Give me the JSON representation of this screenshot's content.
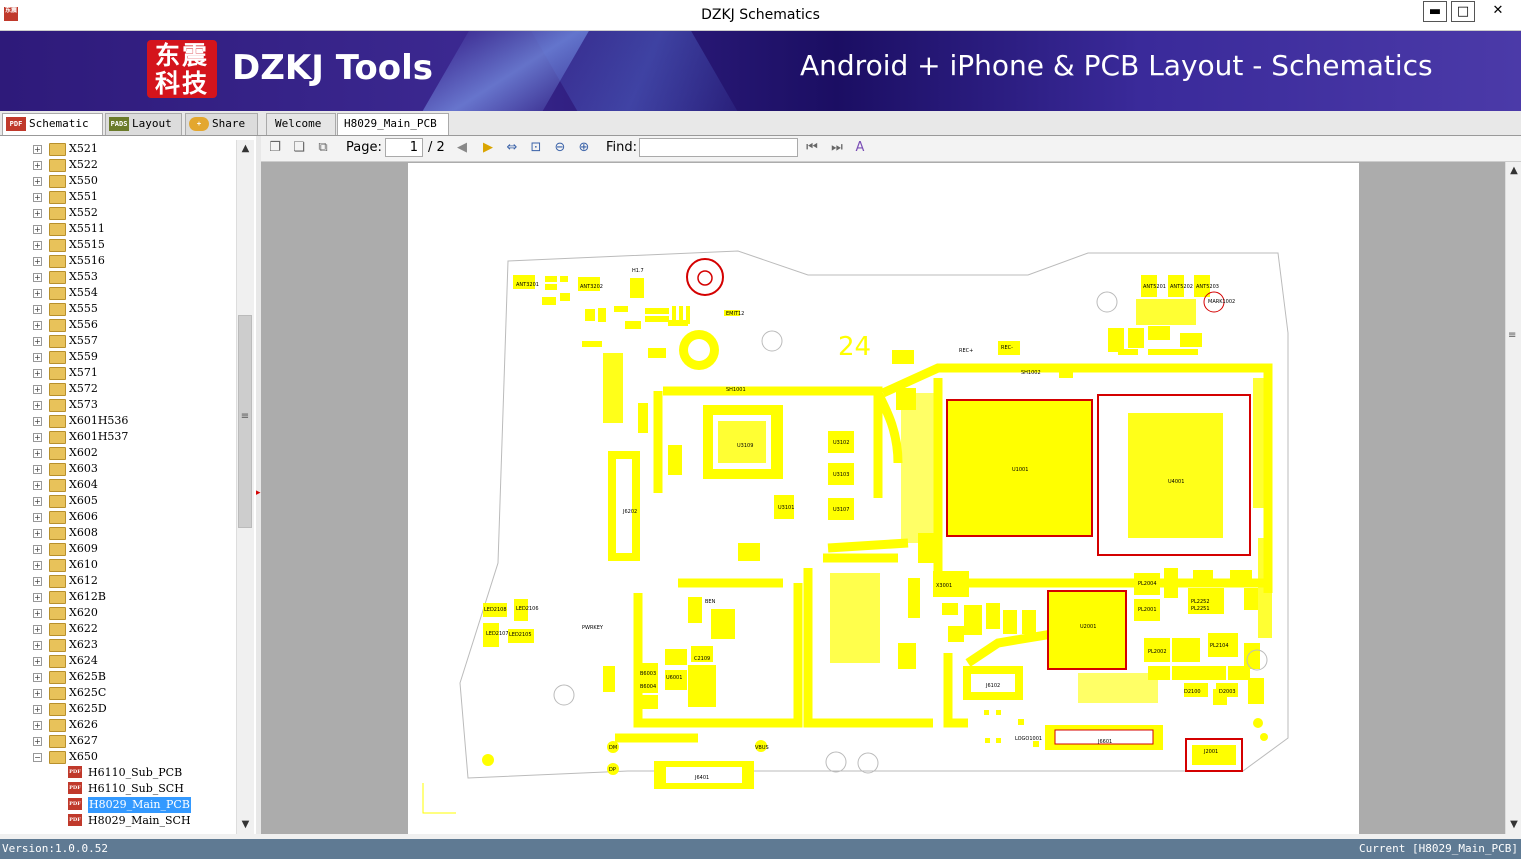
{
  "window": {
    "title": "DZKJ Schematics",
    "minimize": "▬",
    "maximize": "□",
    "close": "✕",
    "icon_text": "东震"
  },
  "banner": {
    "logo_text": "东震科技",
    "brand": "DZKJ Tools",
    "tagline": "Android + iPhone & PCB Layout - Schematics"
  },
  "left_tabs": [
    {
      "label": "Schematic",
      "icon": "pdf-icon",
      "icon_text": "PDF"
    },
    {
      "label": "Layout",
      "icon": "pads-icon",
      "icon_text": "PADS"
    },
    {
      "label": "Share",
      "icon": "cloud-share-icon",
      "icon_text": "+"
    }
  ],
  "doc_tabs": [
    {
      "label": "Welcome"
    },
    {
      "label": "H8029_Main_PCB",
      "close": "✕"
    }
  ],
  "toolbar": {
    "page_label": "Page:",
    "page_current": "1",
    "page_total": "/ 2",
    "find_label": "Find:",
    "find_value": ""
  },
  "tree": {
    "folders": [
      "X521",
      "X522",
      "X550",
      "X551",
      "X552",
      "X5511",
      "X5515",
      "X5516",
      "X553",
      "X554",
      "X555",
      "X556",
      "X557",
      "X559",
      "X571",
      "X572",
      "X573",
      "X601H536",
      "X601H537",
      "X602",
      "X603",
      "X604",
      "X605",
      "X606",
      "X608",
      "X609",
      "X610",
      "X612",
      "X612B",
      "X620",
      "X622",
      "X623",
      "X624",
      "X625B",
      "X625C",
      "X625D",
      "X626",
      "X627",
      "X650"
    ],
    "expanded_folder": "X650",
    "files": [
      "H6110_Sub_PCB",
      "H6110_Sub_SCH",
      "H8029_Main_PCB",
      "H8029_Main_SCH"
    ],
    "selected_file": "H8029_Main_PCB",
    "expander_collapsed": "+",
    "expander_expanded": "−",
    "pdf_icon_text": "PDF"
  },
  "pcb": {
    "board_number": "24",
    "labels": [
      "ANT3201",
      "ANT3202",
      "ANT5201",
      "ANT5202",
      "ANT5203",
      "MARK1002",
      "U3109",
      "U1001",
      "U4001",
      "U2001",
      "U3102",
      "U3103",
      "U3107",
      "U3101",
      "SH1001",
      "SH1002",
      "J6202",
      "J6601",
      "J6102",
      "J6401",
      "J2001",
      "LED2105",
      "LED2106",
      "LED2107",
      "LED2108",
      "PL2004",
      "PL2001",
      "PL2252",
      "PL2251",
      "PL2104",
      "PL2002",
      "D2100",
      "D2003",
      "U6001",
      "B6003",
      "B6004",
      "C2109",
      "PWRKEY",
      "VBUS",
      "DM",
      "DP",
      "LOGO1001",
      "X3001",
      "REC+",
      "REC-",
      "EMIT12",
      "H1.7",
      "BEN"
    ],
    "label_colors": {
      "pad": "#ffff00",
      "outline": "#d40000",
      "board": "#bbbbbb"
    }
  },
  "statusbar": {
    "version": "Version:1.0.0.52",
    "current": "Current [H8029_Main_PCB]"
  },
  "scroll": {
    "up": "▲",
    "down": "▼",
    "grip": "≡",
    "collapse_arrow": "▸"
  }
}
